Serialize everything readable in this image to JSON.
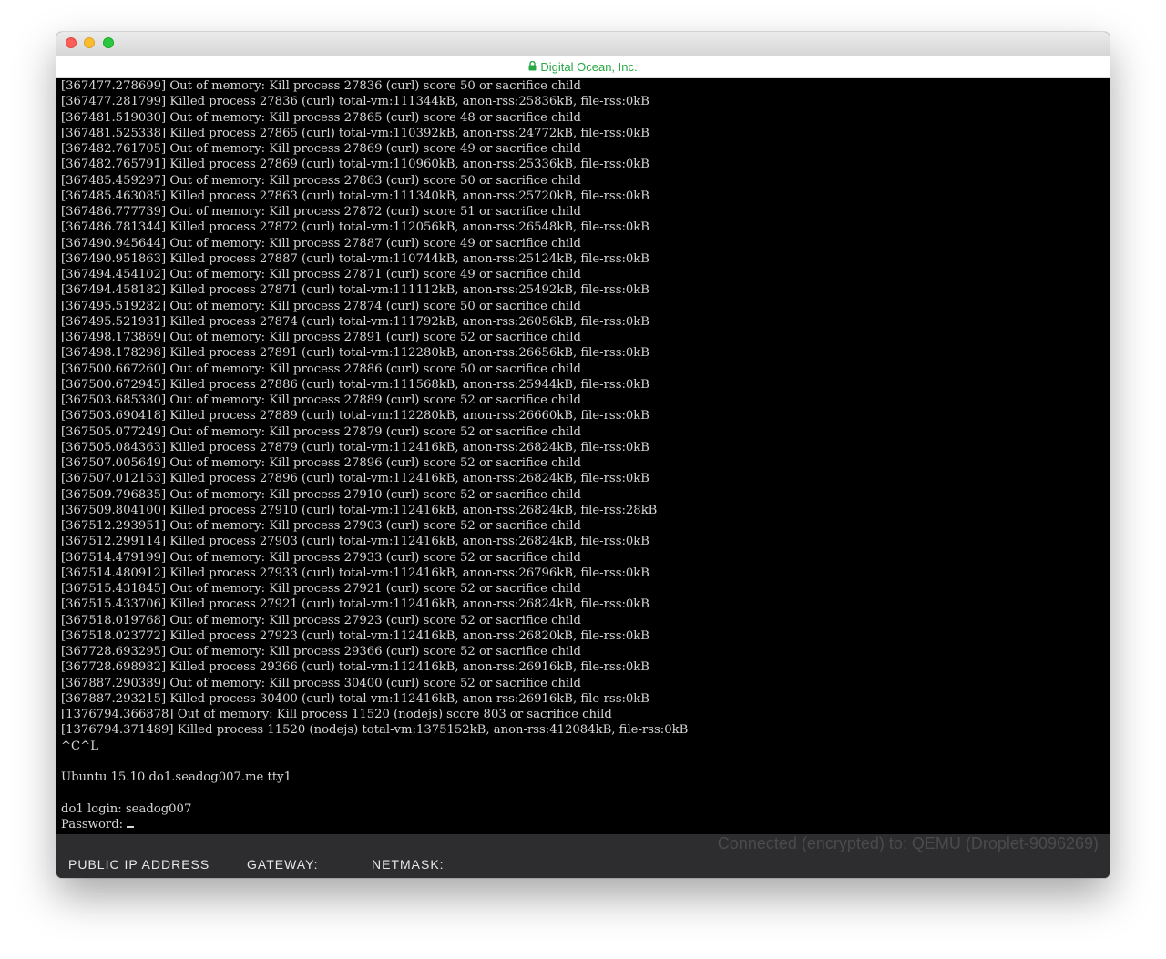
{
  "window": {
    "url_title": "Digital Ocean, Inc."
  },
  "terminal": {
    "lines": [
      "[367477.278699] Out of memory: Kill process 27836 (curl) score 50 or sacrifice child",
      "[367477.281799] Killed process 27836 (curl) total-vm:111344kB, anon-rss:25836kB, file-rss:0kB",
      "[367481.519030] Out of memory: Kill process 27865 (curl) score 48 or sacrifice child",
      "[367481.525338] Killed process 27865 (curl) total-vm:110392kB, anon-rss:24772kB, file-rss:0kB",
      "[367482.761705] Out of memory: Kill process 27869 (curl) score 49 or sacrifice child",
      "[367482.765791] Killed process 27869 (curl) total-vm:110960kB, anon-rss:25336kB, file-rss:0kB",
      "[367485.459297] Out of memory: Kill process 27863 (curl) score 50 or sacrifice child",
      "[367485.463085] Killed process 27863 (curl) total-vm:111340kB, anon-rss:25720kB, file-rss:0kB",
      "[367486.777739] Out of memory: Kill process 27872 (curl) score 51 or sacrifice child",
      "[367486.781344] Killed process 27872 (curl) total-vm:112056kB, anon-rss:26548kB, file-rss:0kB",
      "[367490.945644] Out of memory: Kill process 27887 (curl) score 49 or sacrifice child",
      "[367490.951863] Killed process 27887 (curl) total-vm:110744kB, anon-rss:25124kB, file-rss:0kB",
      "[367494.454102] Out of memory: Kill process 27871 (curl) score 49 or sacrifice child",
      "[367494.458182] Killed process 27871 (curl) total-vm:111112kB, anon-rss:25492kB, file-rss:0kB",
      "[367495.519282] Out of memory: Kill process 27874 (curl) score 50 or sacrifice child",
      "[367495.521931] Killed process 27874 (curl) total-vm:111792kB, anon-rss:26056kB, file-rss:0kB",
      "[367498.173869] Out of memory: Kill process 27891 (curl) score 52 or sacrifice child",
      "[367498.178298] Killed process 27891 (curl) total-vm:112280kB, anon-rss:26656kB, file-rss:0kB",
      "[367500.667260] Out of memory: Kill process 27886 (curl) score 50 or sacrifice child",
      "[367500.672945] Killed process 27886 (curl) total-vm:111568kB, anon-rss:25944kB, file-rss:0kB",
      "[367503.685380] Out of memory: Kill process 27889 (curl) score 52 or sacrifice child",
      "[367503.690418] Killed process 27889 (curl) total-vm:112280kB, anon-rss:26660kB, file-rss:0kB",
      "[367505.077249] Out of memory: Kill process 27879 (curl) score 52 or sacrifice child",
      "[367505.084363] Killed process 27879 (curl) total-vm:112416kB, anon-rss:26824kB, file-rss:0kB",
      "[367507.005649] Out of memory: Kill process 27896 (curl) score 52 or sacrifice child",
      "[367507.012153] Killed process 27896 (curl) total-vm:112416kB, anon-rss:26824kB, file-rss:0kB",
      "[367509.796835] Out of memory: Kill process 27910 (curl) score 52 or sacrifice child",
      "[367509.804100] Killed process 27910 (curl) total-vm:112416kB, anon-rss:26824kB, file-rss:28kB",
      "[367512.293951] Out of memory: Kill process 27903 (curl) score 52 or sacrifice child",
      "[367512.299114] Killed process 27903 (curl) total-vm:112416kB, anon-rss:26824kB, file-rss:0kB",
      "[367514.479199] Out of memory: Kill process 27933 (curl) score 52 or sacrifice child",
      "[367514.480912] Killed process 27933 (curl) total-vm:112416kB, anon-rss:26796kB, file-rss:0kB",
      "[367515.431845] Out of memory: Kill process 27921 (curl) score 52 or sacrifice child",
      "[367515.433706] Killed process 27921 (curl) total-vm:112416kB, anon-rss:26824kB, file-rss:0kB",
      "[367518.019768] Out of memory: Kill process 27923 (curl) score 52 or sacrifice child",
      "[367518.023772] Killed process 27923 (curl) total-vm:112416kB, anon-rss:26820kB, file-rss:0kB",
      "[367728.693295] Out of memory: Kill process 29366 (curl) score 52 or sacrifice child",
      "[367728.698982] Killed process 29366 (curl) total-vm:112416kB, anon-rss:26916kB, file-rss:0kB",
      "[367887.290389] Out of memory: Kill process 30400 (curl) score 52 or sacrifice child",
      "[367887.293215] Killed process 30400 (curl) total-vm:112416kB, anon-rss:26916kB, file-rss:0kB",
      "[1376794.366878] Out of memory: Kill process 11520 (nodejs) score 803 or sacrifice child",
      "[1376794.371489] Killed process 11520 (nodejs) total-vm:1375152kB, anon-rss:412084kB, file-rss:0kB",
      "^C^L",
      "",
      "Ubuntu 15.10 do1.seadog007.me tty1",
      "",
      "do1 login: seadog007",
      "Password: "
    ]
  },
  "footer": {
    "connected_text": "Connected (encrypted) to: QEMU (Droplet-9096269)",
    "public_ip_label": "PUBLIC IP ADDRESS",
    "gateway_label": "GATEWAY:",
    "netmask_label": "NETMASK:"
  }
}
